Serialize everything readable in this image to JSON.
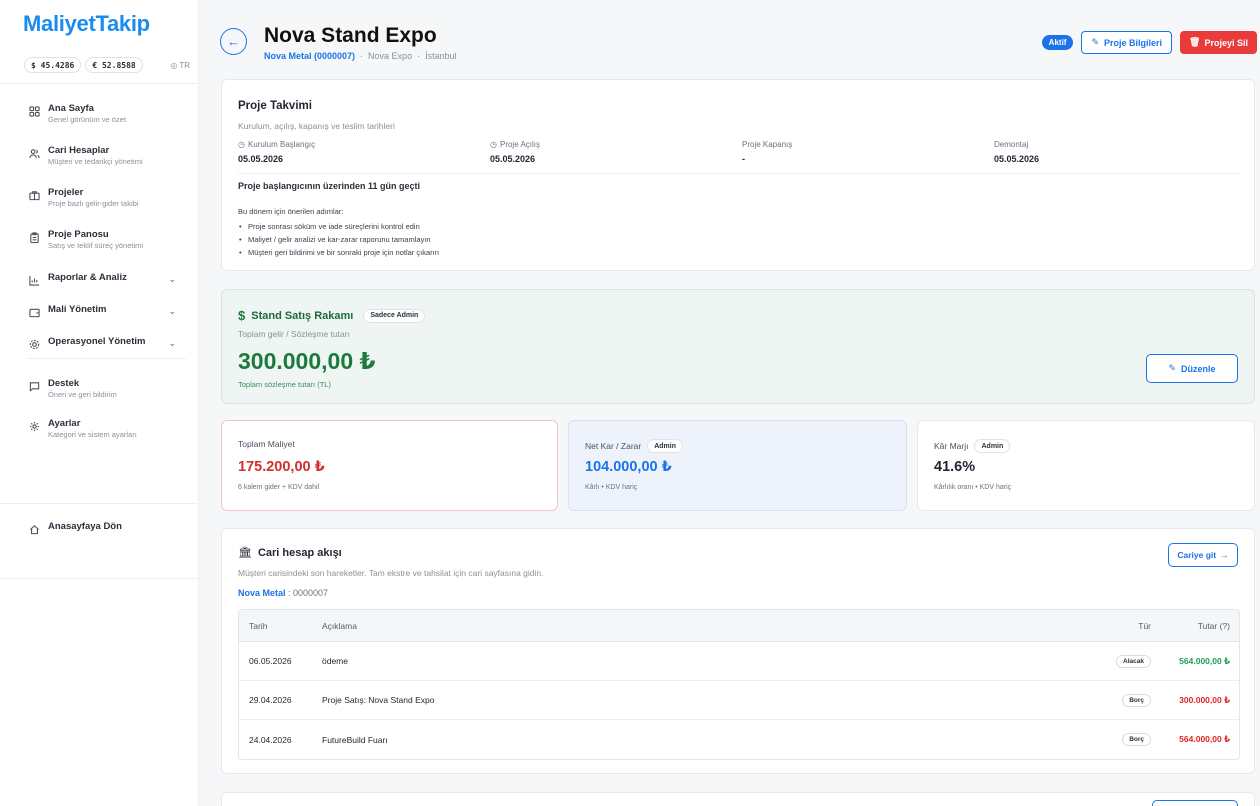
{
  "app": {
    "logo": "MaliyetTakip",
    "rates": {
      "usd": "$ 45.4286",
      "eur": "€ 52.8588",
      "lang": "TR"
    }
  },
  "sidebar": {
    "items": [
      {
        "title": "Ana Sayfa",
        "sub": "Genel görünüm ve özet",
        "icon": "dashboard-icon"
      },
      {
        "title": "Cari Hesaplar",
        "sub": "Müşteri ve tedarikçi yönetimi",
        "icon": "users-icon"
      },
      {
        "title": "Projeler",
        "sub": "Proje bazlı gelir-gider takibi",
        "icon": "briefcase-icon"
      },
      {
        "title": "Proje Panosu",
        "sub": "Satış ve teklif süreç yönetimi",
        "icon": "clipboard-icon"
      },
      {
        "title": "Raporlar & Analiz",
        "sub": "",
        "icon": "chart-icon"
      },
      {
        "title": "Mali Yönetim",
        "sub": "",
        "icon": "wallet-icon"
      },
      {
        "title": "Operasyonel Yönetim",
        "sub": "",
        "icon": "gear-icon"
      },
      {
        "title": "Destek",
        "sub": "Öneri ve geri bildirim",
        "icon": "message-icon"
      },
      {
        "title": "Ayarlar",
        "sub": "Kategori ve sistem ayarları",
        "icon": "settings-icon"
      }
    ],
    "home_link": "Anasayfaya Dön"
  },
  "header": {
    "title": "Nova Stand Expo",
    "client": "Nova Metal (0000007)",
    "project": "Nova Expo",
    "city": "İstanbul",
    "status": "Aktif",
    "info_button": "Proje Bilgileri",
    "delete_button": "Projeyi Sil"
  },
  "schedule": {
    "title": "Proje Takvimi",
    "subtitle": "Kurulum, açılış, kapanış ve teslim tarihleri",
    "columns": [
      {
        "label": "Kurulum Başlangıç",
        "value": "05.05.2026"
      },
      {
        "label": "Proje Açılış",
        "value": "05.05.2026"
      },
      {
        "label": "Proje Kapanış",
        "value": "-"
      },
      {
        "label": "Demontaj",
        "value": "05.05.2026"
      }
    ],
    "notice": "Proje başlangıcının üzerinden 11 gün geçti",
    "lead": "Bu dönem için önerilen adımlar:",
    "steps": [
      "Proje sonrası söküm ve iade süreçlerini kontrol edin",
      "Maliyet / gelir analizi ve kar-zarar raporunu tamamlayın",
      "Müşteri geri bildirimi ve bir sonraki proje için notlar çıkarın"
    ]
  },
  "sales": {
    "title": "Stand Satış Rakamı",
    "badge": "Sadece Admin",
    "subtitle": "Toplam gelir / Sözleşme tutarı",
    "amount": "300.000,00 ₺",
    "note": "Toplam sözleşme tutarı (TL)",
    "edit_button": "Düzenle"
  },
  "stats": [
    {
      "label": "Toplam Maliyet",
      "badge": "",
      "value": "175.200,00 ₺",
      "sub": "6 kalem gider + KDV dahil",
      "color": "#d32f2f"
    },
    {
      "label": "Net Kar / Zarar",
      "badge": "Admin",
      "value": "104.000,00 ₺",
      "sub": "Kârlı • KDV hariç",
      "color": "#1a73e8"
    },
    {
      "label": "Kâr Marjı",
      "badge": "Admin",
      "value": "41.6%",
      "sub": "Kârlılık oranı • KDV hariç",
      "color": "#1f2430"
    }
  ],
  "ledger": {
    "title": "Cari hesap akışı",
    "subtitle": "Müşteri carisindeki son hareketler. Tam ekstre ve tahsilat için cari sayfasına gidin.",
    "client_name": "Nova Metal",
    "client_code": " : 0000007",
    "go_button": "Cariye git",
    "columns": {
      "date": "Tarih",
      "desc": "Açıklama",
      "type": "Tür",
      "amount": "Tutar (?)"
    },
    "rows": [
      {
        "date": "06.05.2026",
        "desc": "ödeme",
        "type": "Alacak",
        "amount": "564.000,00 ₺",
        "color": "#1e9e52"
      },
      {
        "date": "29.04.2026",
        "desc": "Proje Satış: Nova Stand Expo",
        "type": "Borç",
        "amount": "300.000,00 ₺",
        "color": "#e02424"
      },
      {
        "date": "24.04.2026",
        "desc": "FutureBuild Fuarı",
        "type": "Borç",
        "amount": "564.000,00 ₺",
        "color": "#e02424"
      }
    ]
  }
}
